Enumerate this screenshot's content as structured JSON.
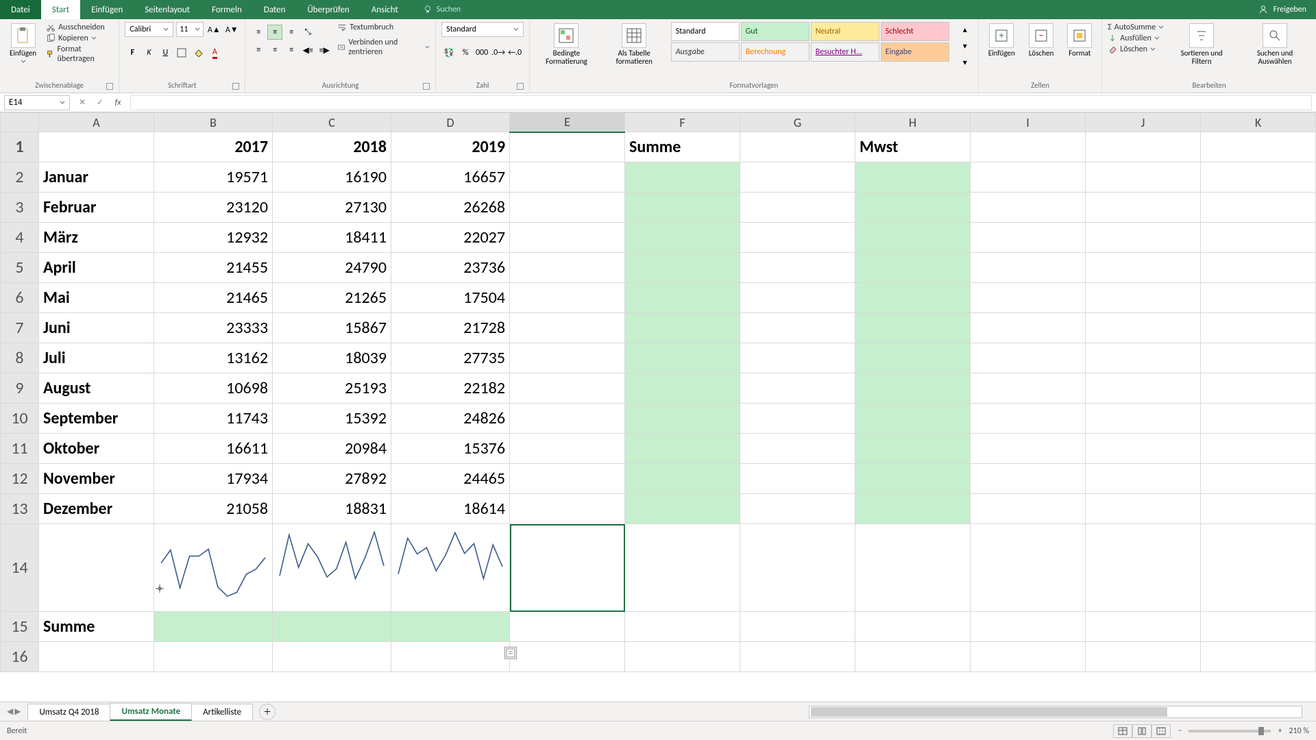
{
  "app": {
    "share_label": "Freigeben",
    "search_placeholder": "Suchen"
  },
  "menu": {
    "file": "Datei",
    "start": "Start",
    "einfuegen": "Einfügen",
    "seitenlayout": "Seitenlayout",
    "formeln": "Formeln",
    "daten": "Daten",
    "ueberpruefen": "Überprüfen",
    "ansicht": "Ansicht"
  },
  "ribbon": {
    "clipboard": {
      "paste": "Einfügen",
      "cut": "Ausschneiden",
      "copy": "Kopieren",
      "format_painter": "Format übertragen",
      "group": "Zwischenablage"
    },
    "font": {
      "name": "Calibri",
      "size": "11",
      "group": "Schriftart"
    },
    "alignment": {
      "wrap": "Textumbruch",
      "merge": "Verbinden und zentrieren",
      "group": "Ausrichtung"
    },
    "number": {
      "format": "Standard",
      "group": "Zahl"
    },
    "styles": {
      "cond": "Bedingte Formatierung",
      "table": "Als Tabelle formatieren",
      "standard": "Standard",
      "gut": "Gut",
      "neutral": "Neutral",
      "schlecht": "Schlecht",
      "ausgabe": "Ausgabe",
      "berechnung": "Berechnung",
      "besuchter": "Besuchter H...",
      "eingabe": "Eingabe",
      "group": "Formatvorlagen"
    },
    "cells": {
      "insert": "Einfügen",
      "delete": "Löschen",
      "format": "Format",
      "group": "Zellen"
    },
    "editing": {
      "autosum": "AutoSumme",
      "fill": "Ausfüllen",
      "clear": "Löschen",
      "sort": "Sortieren und Filtern",
      "find": "Suchen und Auswählen",
      "group": "Bearbeiten"
    }
  },
  "formula_bar": {
    "cell_ref": "E14",
    "formula": ""
  },
  "columns": [
    "A",
    "B",
    "C",
    "D",
    "E",
    "F",
    "G",
    "H",
    "I",
    "J",
    "K"
  ],
  "headers": {
    "b": "2017",
    "c": "2018",
    "d": "2019",
    "f": "Summe",
    "h": "Mwst"
  },
  "rows": [
    {
      "n": 1
    },
    {
      "n": 2,
      "a": "Januar",
      "b": 19571,
      "c": 16190,
      "d": 16657
    },
    {
      "n": 3,
      "a": "Februar",
      "b": 23120,
      "c": 27130,
      "d": 26268
    },
    {
      "n": 4,
      "a": "März",
      "b": 12932,
      "c": 18411,
      "d": 22027
    },
    {
      "n": 5,
      "a": "April",
      "b": 21455,
      "c": 24790,
      "d": 23736
    },
    {
      "n": 6,
      "a": "Mai",
      "b": 21465,
      "c": 21265,
      "d": 17504
    },
    {
      "n": 7,
      "a": "Juni",
      "b": 23333,
      "c": 15867,
      "d": 21728
    },
    {
      "n": 8,
      "a": "Juli",
      "b": 13162,
      "c": 18039,
      "d": 27735
    },
    {
      "n": 9,
      "a": "August",
      "b": 10698,
      "c": 25193,
      "d": 22182
    },
    {
      "n": 10,
      "a": "September",
      "b": 11743,
      "c": 15392,
      "d": 24826
    },
    {
      "n": 11,
      "a": "Oktober",
      "b": 16611,
      "c": 20984,
      "d": 15376
    },
    {
      "n": 12,
      "a": "November",
      "b": 17934,
      "c": 27892,
      "d": 24465
    },
    {
      "n": 13,
      "a": "Dezember",
      "b": 21058,
      "c": 18831,
      "d": 18614
    }
  ],
  "row15_label": "Summe",
  "chart_data": [
    {
      "type": "line",
      "x": [
        "Jan",
        "Feb",
        "Mär",
        "Apr",
        "Mai",
        "Jun",
        "Jul",
        "Aug",
        "Sep",
        "Okt",
        "Nov",
        "Dez"
      ],
      "values": [
        19571,
        23120,
        12932,
        21455,
        21465,
        23333,
        13162,
        10698,
        11743,
        16611,
        17934,
        21058
      ],
      "title": "2017",
      "ylim": [
        10000,
        28000
      ]
    },
    {
      "type": "line",
      "x": [
        "Jan",
        "Feb",
        "Mär",
        "Apr",
        "Mai",
        "Jun",
        "Jul",
        "Aug",
        "Sep",
        "Okt",
        "Nov",
        "Dez"
      ],
      "values": [
        16190,
        27130,
        18411,
        24790,
        21265,
        15867,
        18039,
        25193,
        15392,
        20984,
        27892,
        18831
      ],
      "title": "2018",
      "ylim": [
        10000,
        28000
      ]
    },
    {
      "type": "line",
      "x": [
        "Jan",
        "Feb",
        "Mär",
        "Apr",
        "Mai",
        "Jun",
        "Jul",
        "Aug",
        "Sep",
        "Okt",
        "Nov",
        "Dez"
      ],
      "values": [
        16657,
        26268,
        22027,
        23736,
        17504,
        21728,
        27735,
        22182,
        24826,
        15376,
        24465,
        18614
      ],
      "title": "2019",
      "ylim": [
        10000,
        28000
      ]
    }
  ],
  "sheet_tabs": {
    "t1": "Umsatz Q4 2018",
    "t2": "Umsatz Monate",
    "t3": "Artikelliste"
  },
  "status": {
    "ready": "Bereit",
    "zoom": "210 %"
  }
}
